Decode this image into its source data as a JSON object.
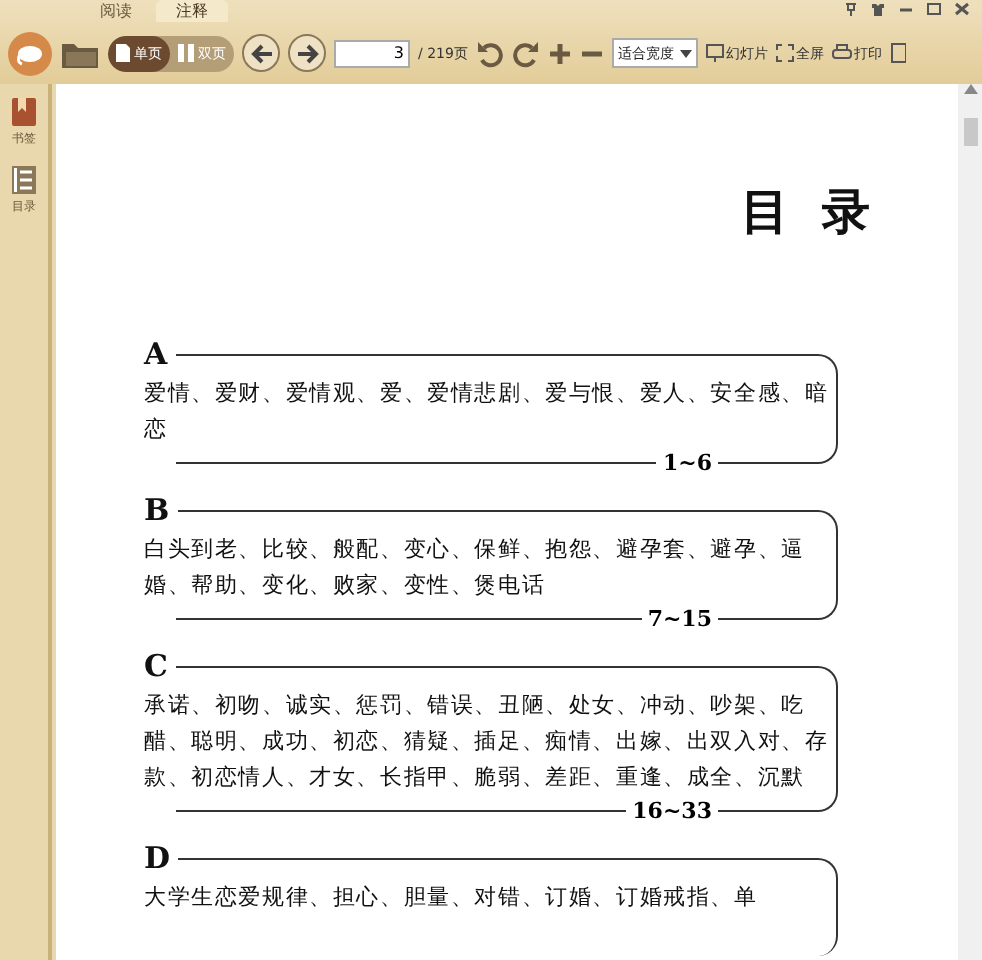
{
  "tabs": [
    {
      "label": "阅读",
      "selected": false
    },
    {
      "label": "注释",
      "selected": true
    }
  ],
  "toolbar": {
    "view_modes": [
      {
        "label": "单页",
        "selected": true
      },
      {
        "label": "双页",
        "selected": false
      }
    ],
    "page_input": "3",
    "page_total": "/ 219页",
    "zoom_select": "适合宽度",
    "actions": [
      "幻灯片",
      "全屏",
      "打印"
    ]
  },
  "sidebar": {
    "items": [
      {
        "label": "书签",
        "kind": "bookmark"
      },
      {
        "label": "目录",
        "kind": "toc"
      }
    ]
  },
  "page": {
    "title": "目 录",
    "sections": [
      {
        "letter": "A",
        "entries": "爱情、爱财、爱情观、爱、爱情悲剧、爱与恨、爱人、安全感、暗恋",
        "pages": "1~6"
      },
      {
        "letter": "B",
        "entries": "白头到老、比较、般配、变心、保鲜、抱怨、避孕套、避孕、逼婚、帮助、变化、败家、变性、煲电话",
        "pages": "7~15"
      },
      {
        "letter": "C",
        "entries": "承诺、初吻、诚实、惩罚、错误、丑陋、处女、冲动、吵架、吃醋、聪明、成功、初恋、猜疑、插足、痴情、出嫁、出双入对、存款、初恋情人、才女、长指甲、脆弱、差距、重逢、成全、沉默",
        "pages": "16~33"
      },
      {
        "letter": "D",
        "entries": "大学生恋爱规律、担心、胆量、对错、订婚、订婚戒指、单"
      }
    ]
  }
}
